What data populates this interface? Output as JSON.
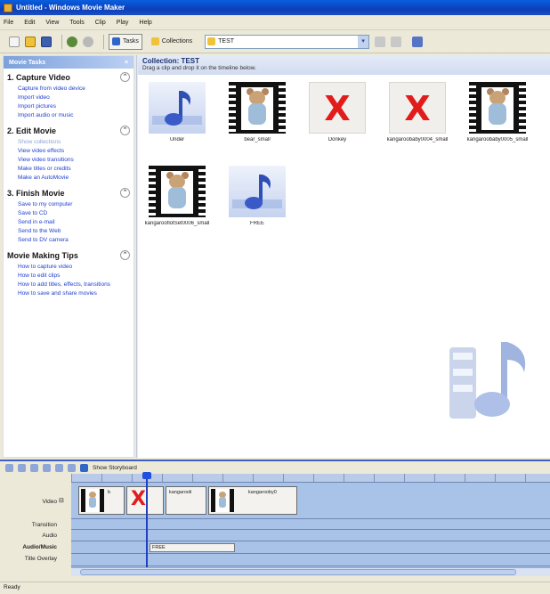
{
  "window": {
    "title": "Untitled - Windows Movie Maker"
  },
  "menu": [
    "File",
    "Edit",
    "View",
    "Tools",
    "Clip",
    "Play",
    "Help"
  ],
  "toolbar": {
    "tasks_label": "Tasks",
    "collections_label": "Collections",
    "collection_value": "TEST"
  },
  "tasks_pane": {
    "header": "Movie Tasks",
    "sections": [
      {
        "title": "1. Capture Video",
        "items": [
          {
            "label": "Capture from video device",
            "enabled": true
          },
          {
            "label": "Import video",
            "enabled": true
          },
          {
            "label": "Import pictures",
            "enabled": true
          },
          {
            "label": "Import audio or music",
            "enabled": true
          }
        ]
      },
      {
        "title": "2. Edit Movie",
        "items": [
          {
            "label": "Show collections",
            "enabled": false
          },
          {
            "label": "View video effects",
            "enabled": true
          },
          {
            "label": "View video transitions",
            "enabled": true
          },
          {
            "label": "Make titles or credits",
            "enabled": true
          },
          {
            "label": "Make an AutoMovie",
            "enabled": true
          }
        ]
      },
      {
        "title": "3. Finish Movie",
        "items": [
          {
            "label": "Save to my computer",
            "enabled": true
          },
          {
            "label": "Save to CD",
            "enabled": true
          },
          {
            "label": "Send in e-mail",
            "enabled": true
          },
          {
            "label": "Send to the Web",
            "enabled": true
          },
          {
            "label": "Send to DV camera",
            "enabled": true
          }
        ]
      },
      {
        "title": "Movie Making Tips",
        "items": [
          {
            "label": "How to capture video",
            "enabled": true
          },
          {
            "label": "How to edit clips",
            "enabled": true
          },
          {
            "label": "How to add titles, effects, transitions",
            "enabled": true
          },
          {
            "label": "How to save and share movies",
            "enabled": true
          }
        ]
      }
    ]
  },
  "collection": {
    "title": "Collection: TEST",
    "hint": "Drag a clip and drop it on the timeline below.",
    "clips": [
      {
        "name": "Under",
        "kind": "audio"
      },
      {
        "name": "bear_small",
        "kind": "video"
      },
      {
        "name": "Donkey",
        "kind": "missing"
      },
      {
        "name": "kangaroobaby0004_small",
        "kind": "missing"
      },
      {
        "name": "kangaroobaby0005_small",
        "kind": "video"
      },
      {
        "name": "kangarooflotSet0006_small",
        "kind": "video"
      },
      {
        "name": "FREE",
        "kind": "audio"
      }
    ]
  },
  "timeline": {
    "storyboard_label": "Show Storyboard",
    "track_labels": {
      "video": "Video",
      "transition": "Transition",
      "audio": "Audio",
      "audio_music": "Audio/Music",
      "title_overlay": "Title Overlay"
    },
    "video_clips": [
      {
        "name": "b",
        "kind": "video"
      },
      {
        "name": "",
        "kind": "missing"
      },
      {
        "name": "kangarooli",
        "kind": "missing"
      },
      {
        "name": "kangarooby0",
        "kind": "video"
      }
    ],
    "audio_clip": {
      "name": "FREE"
    }
  },
  "status": {
    "text": "Ready"
  },
  "colors": {
    "accent": "#0b3fb8",
    "missing_x": "#e21b1b",
    "timeline_bg": "#a8c2e8"
  }
}
